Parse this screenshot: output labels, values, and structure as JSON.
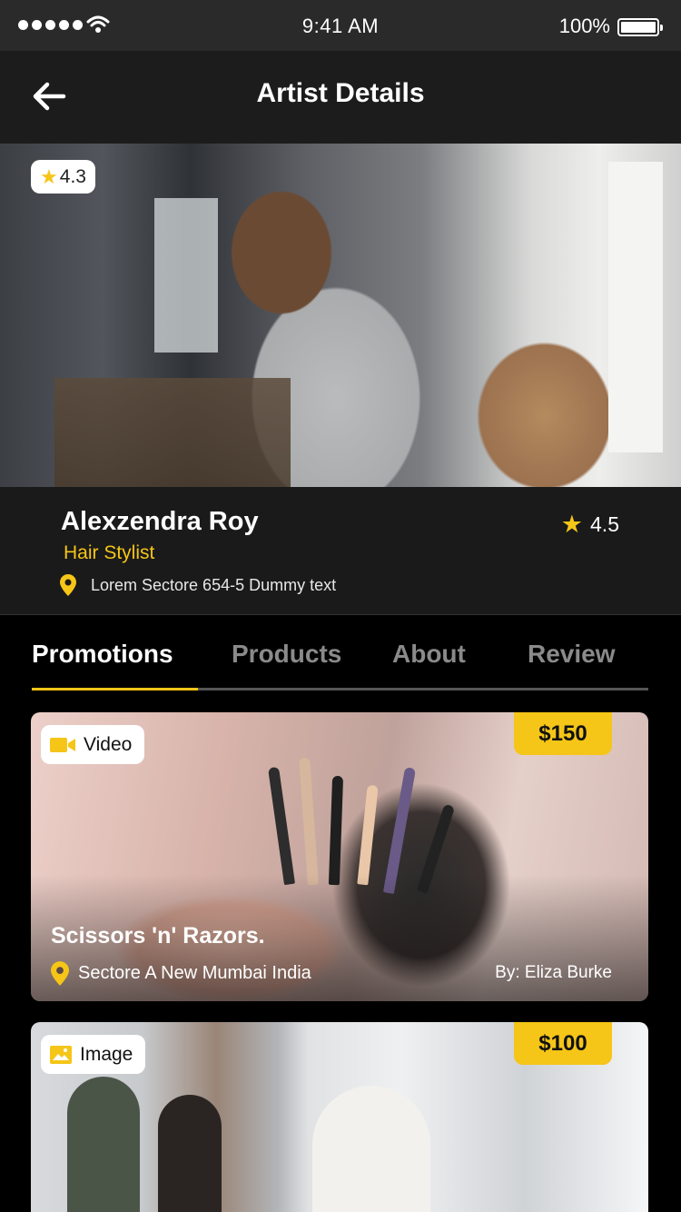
{
  "status_bar": {
    "time": "9:41 AM",
    "battery": "100%"
  },
  "header": {
    "title": "Artist Details",
    "back_icon": "arrow-left-icon"
  },
  "hero": {
    "rating": "4.3"
  },
  "artist": {
    "name": "Alexzendra Roy",
    "role": "Hair Stylist",
    "location": "Lorem Sectore 654-5 Dummy text",
    "rating": "4.5"
  },
  "tabs": [
    {
      "label": "Promotions",
      "active": true
    },
    {
      "label": "Products",
      "active": false
    },
    {
      "label": "About",
      "active": false
    },
    {
      "label": "Review",
      "active": false
    }
  ],
  "cards": [
    {
      "type_label": "Video",
      "type_icon": "video-camera-icon",
      "price": "$150",
      "title": "Scissors 'n' Razors.",
      "location": "Sectore A New Mumbai India",
      "author": "By: Eliza Burke"
    },
    {
      "type_label": "Image",
      "type_icon": "image-icon",
      "price": "$100"
    }
  ],
  "colors": {
    "accent": "#f5c518",
    "background": "#000000",
    "header": "#1c1c1c",
    "tab_inactive": "#8a8a8a"
  }
}
